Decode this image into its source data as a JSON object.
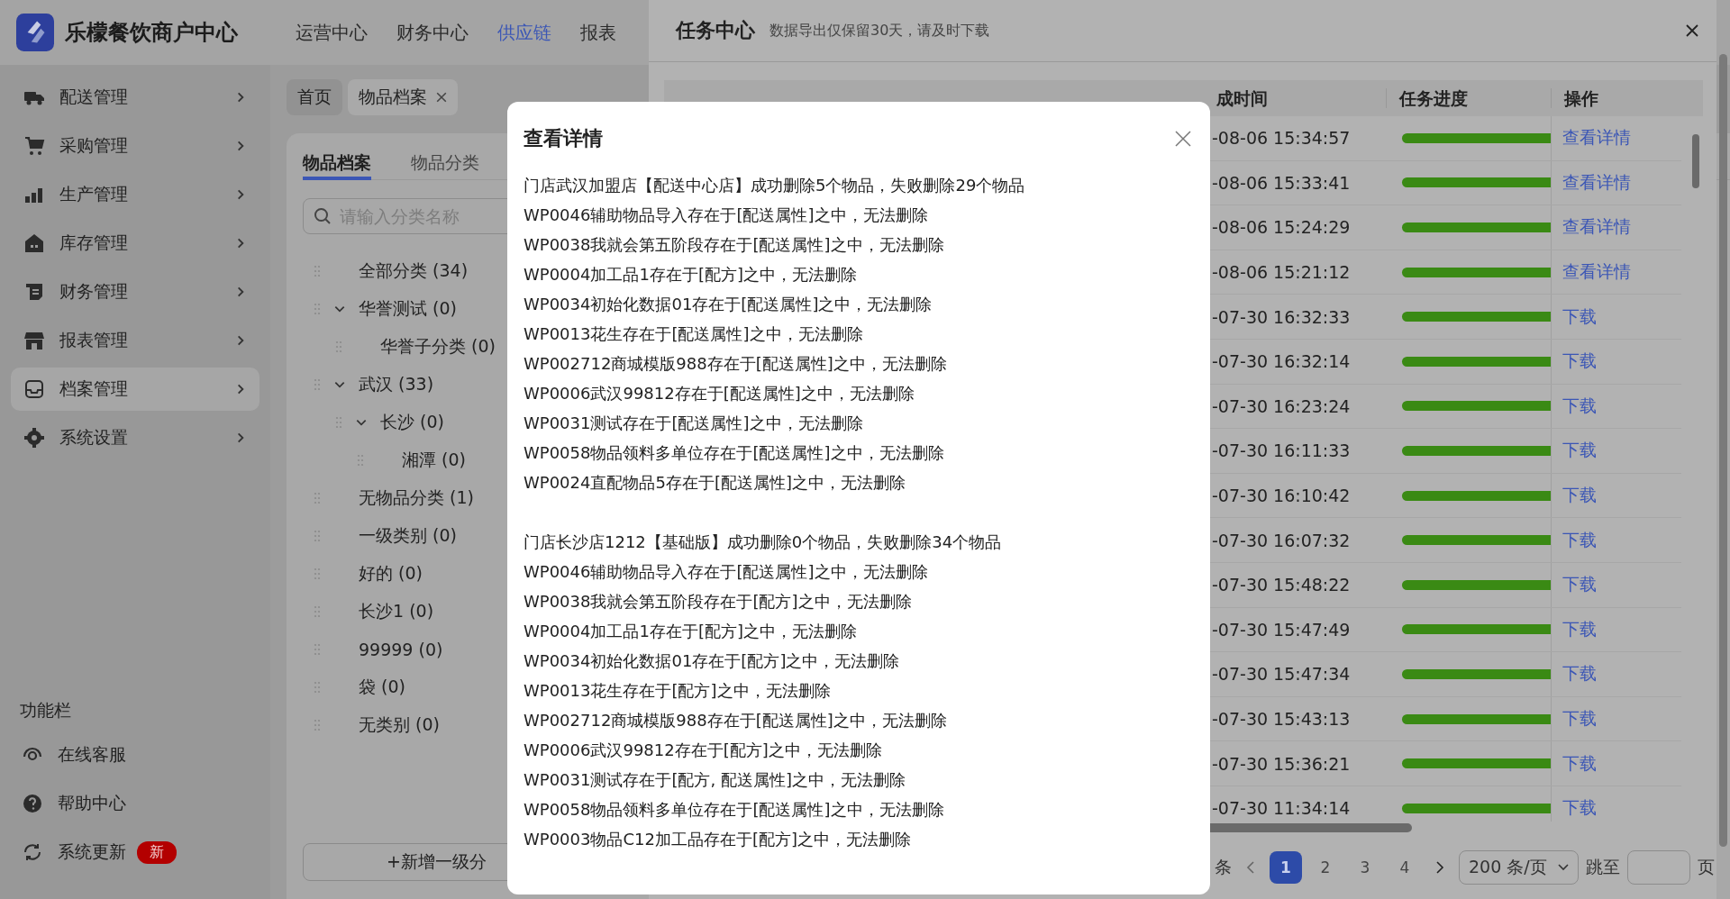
{
  "app": {
    "title": "乐檬餐饮商户中心"
  },
  "top_nav": [
    {
      "label": "运营中心",
      "selected": false
    },
    {
      "label": "财务中心",
      "selected": false
    },
    {
      "label": "供应链",
      "selected": true
    },
    {
      "label": "报表",
      "selected": false
    }
  ],
  "sidebar": {
    "items": [
      {
        "label": "配送管理",
        "selected": false
      },
      {
        "label": "采购管理",
        "selected": false
      },
      {
        "label": "生产管理",
        "selected": false
      },
      {
        "label": "库存管理",
        "selected": false
      },
      {
        "label": "财务管理",
        "selected": false
      },
      {
        "label": "报表管理",
        "selected": false
      },
      {
        "label": "档案管理",
        "selected": true
      },
      {
        "label": "系统设置",
        "selected": false
      }
    ],
    "section_title": "功能栏",
    "tools": [
      {
        "label": "在线客服"
      },
      {
        "label": "帮助中心"
      },
      {
        "label": "系统更新",
        "badge": "新"
      }
    ]
  },
  "page_tabs": [
    {
      "label": "首页",
      "selected": false
    },
    {
      "label": "物品档案",
      "selected": true
    }
  ],
  "card_tabs": [
    {
      "label": "物品档案",
      "selected": true
    },
    {
      "label": "物品分类",
      "selected": false
    }
  ],
  "search": {
    "placeholder": "请输入分类名称"
  },
  "tree": [
    {
      "label": "全部分类 (34)"
    },
    {
      "label": "华誉测试 (0)",
      "expanded": true,
      "children": [
        {
          "label": "华誉子分类 (0)"
        }
      ]
    },
    {
      "label": "武汉 (33)",
      "expanded": true,
      "children": [
        {
          "label": "长沙 (0)",
          "expanded": true,
          "children": [
            {
              "label": "湘潭 (0)"
            }
          ]
        }
      ]
    },
    {
      "label": "无物品分类 (1)"
    },
    {
      "label": "一级类别 (0)"
    },
    {
      "label": "好的 (0)"
    },
    {
      "label": "长沙1 (0)"
    },
    {
      "label": "99999 (0)"
    },
    {
      "label": "袋 (0)"
    },
    {
      "label": "无类别 (0)"
    }
  ],
  "add_button": "+新增一级分",
  "task_center": {
    "title": "任务中心",
    "subtitle": "数据导出仅保留30天，请及时下载",
    "columns": [
      "成时间",
      "任务进度",
      "操作"
    ],
    "rows": [
      {
        "completed": "-08-06 15:34:57",
        "level": 1,
        "action": "查看详情"
      },
      {
        "completed": "-08-06 15:33:41",
        "level": 1,
        "action": "查看详情"
      },
      {
        "completed": "-08-06 15:24:29",
        "level": 1,
        "action": "查看详情"
      },
      {
        "completed": "-08-06 15:21:12",
        "level": 1,
        "action": "查看详情"
      },
      {
        "completed": "-07-30 16:32:33",
        "level": 1,
        "action": "下载"
      },
      {
        "completed": "-07-30 16:32:14",
        "level": 1,
        "action": "下载"
      },
      {
        "completed": "-07-30 16:23:24",
        "level": 1,
        "action": "下载"
      },
      {
        "completed": "-07-30 16:11:33",
        "level": 1,
        "action": "下载"
      },
      {
        "completed": "-07-30 16:10:42",
        "level": 1,
        "action": "下载"
      },
      {
        "completed": "-07-30 16:07:32",
        "level": 1,
        "action": "下载"
      },
      {
        "completed": "-07-30 15:48:22",
        "level": 1,
        "action": "下载"
      },
      {
        "completed": "-07-30 15:47:49",
        "level": 1,
        "action": "下载"
      },
      {
        "completed": "-07-30 15:47:34",
        "level": 1,
        "action": "下载"
      },
      {
        "completed": "-07-30 15:43:13",
        "level": 1,
        "action": "下载"
      },
      {
        "completed": "-07-30 15:36:21",
        "level": 1,
        "action": "下载"
      },
      {
        "completed": "-07-30 11:34:14",
        "level": 1,
        "action": "下载"
      }
    ],
    "pagination": {
      "total": "条",
      "pages": [
        {
          "label": "1",
          "selected": true
        },
        {
          "label": "2",
          "selected": false
        },
        {
          "label": "3",
          "selected": false
        },
        {
          "label": "4",
          "selected": false
        }
      ],
      "page_size": "200 条/页",
      "jump_label": "跳至",
      "page_unit": "页"
    }
  },
  "modal": {
    "title": "查看详情",
    "groups": [
      {
        "summary": "门店武汉加盟店【配送中心店】成功删除5个物品，失败删除29个物品",
        "lines": [
          "WP0046辅助物品导入存在于[配送属性]之中，无法删除",
          "WP0038我就会第五阶段存在于[配送属性]之中，无法删除",
          "WP0004加工品1存在于[配方]之中，无法删除",
          "WP0034初始化数据01存在于[配送属性]之中，无法删除",
          "WP0013花生存在于[配送属性]之中，无法删除",
          "WP002712商城模版988存在于[配送属性]之中，无法删除",
          "WP0006武汉99812存在于[配送属性]之中，无法删除",
          "WP0031测试存在于[配送属性]之中，无法删除",
          "WP0058物品领料多单位存在于[配送属性]之中，无法删除",
          "WP0024直配物品5存在于[配送属性]之中，无法删除"
        ]
      },
      {
        "summary": "门店长沙店1212【基础版】成功删除0个物品，失败删除34个物品",
        "lines": [
          "WP0046辅助物品导入存在于[配送属性]之中，无法删除",
          "WP0038我就会第五阶段存在于[配方]之中，无法删除",
          "WP0004加工品1存在于[配方]之中，无法删除",
          "WP0034初始化数据01存在于[配方]之中，无法删除",
          "WP0013花生存在于[配方]之中，无法删除",
          "WP002712商城模版988存在于[配送属性]之中，无法删除",
          "WP0006武汉99812存在于[配方]之中，无法删除",
          "WP0031测试存在于[配方, 配送属性]之中，无法删除",
          "WP0058物品领料多单位存在于[配送属性]之中，无法删除",
          "WP0003物品C12加工品存在于[配方]之中，无法删除"
        ]
      }
    ]
  }
}
